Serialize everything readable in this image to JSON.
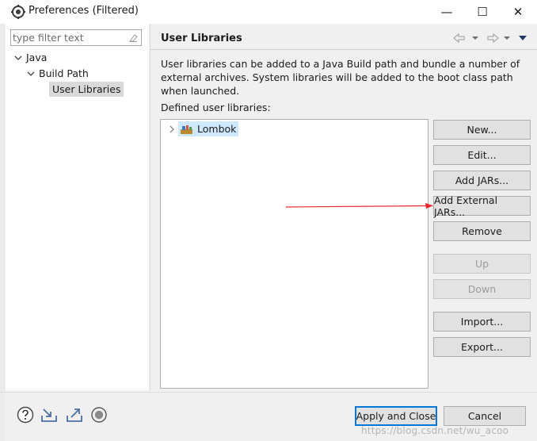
{
  "window": {
    "title": "Preferences (Filtered)",
    "minimize_glyph": "—",
    "maximize_glyph": "☐",
    "close_glyph": "✕"
  },
  "filter": {
    "placeholder": "type filter text",
    "value": ""
  },
  "tree": {
    "items": [
      {
        "label": "Java",
        "expanded": true
      },
      {
        "label": "Build Path",
        "expanded": true
      },
      {
        "label": "User Libraries",
        "selected": true
      }
    ]
  },
  "page": {
    "title": "User Libraries",
    "description": "User libraries can be added to a Java Build path and bundle a number of external archives. System libraries will be added to the boot class path when launched.",
    "defined_label": "Defined user libraries:",
    "libraries": [
      "Lombok"
    ]
  },
  "buttons": {
    "new": "New...",
    "edit": "Edit...",
    "add_jars": "Add JARs...",
    "add_external_jars": "Add External JARs...",
    "remove": "Remove",
    "up": "Up",
    "down": "Down",
    "import": "Import...",
    "export": "Export..."
  },
  "footer": {
    "apply_close": "Apply and Close",
    "cancel": "Cancel",
    "icons": [
      "help-icon",
      "import-prefs-icon",
      "export-prefs-icon",
      "record-icon"
    ]
  },
  "watermark": "https://blog.csdn.net/wu_acoo",
  "colors": {
    "selection": "#cde8ff",
    "annotation_arrow": "#e8262b",
    "tree_selection": "#d9d9d9"
  }
}
